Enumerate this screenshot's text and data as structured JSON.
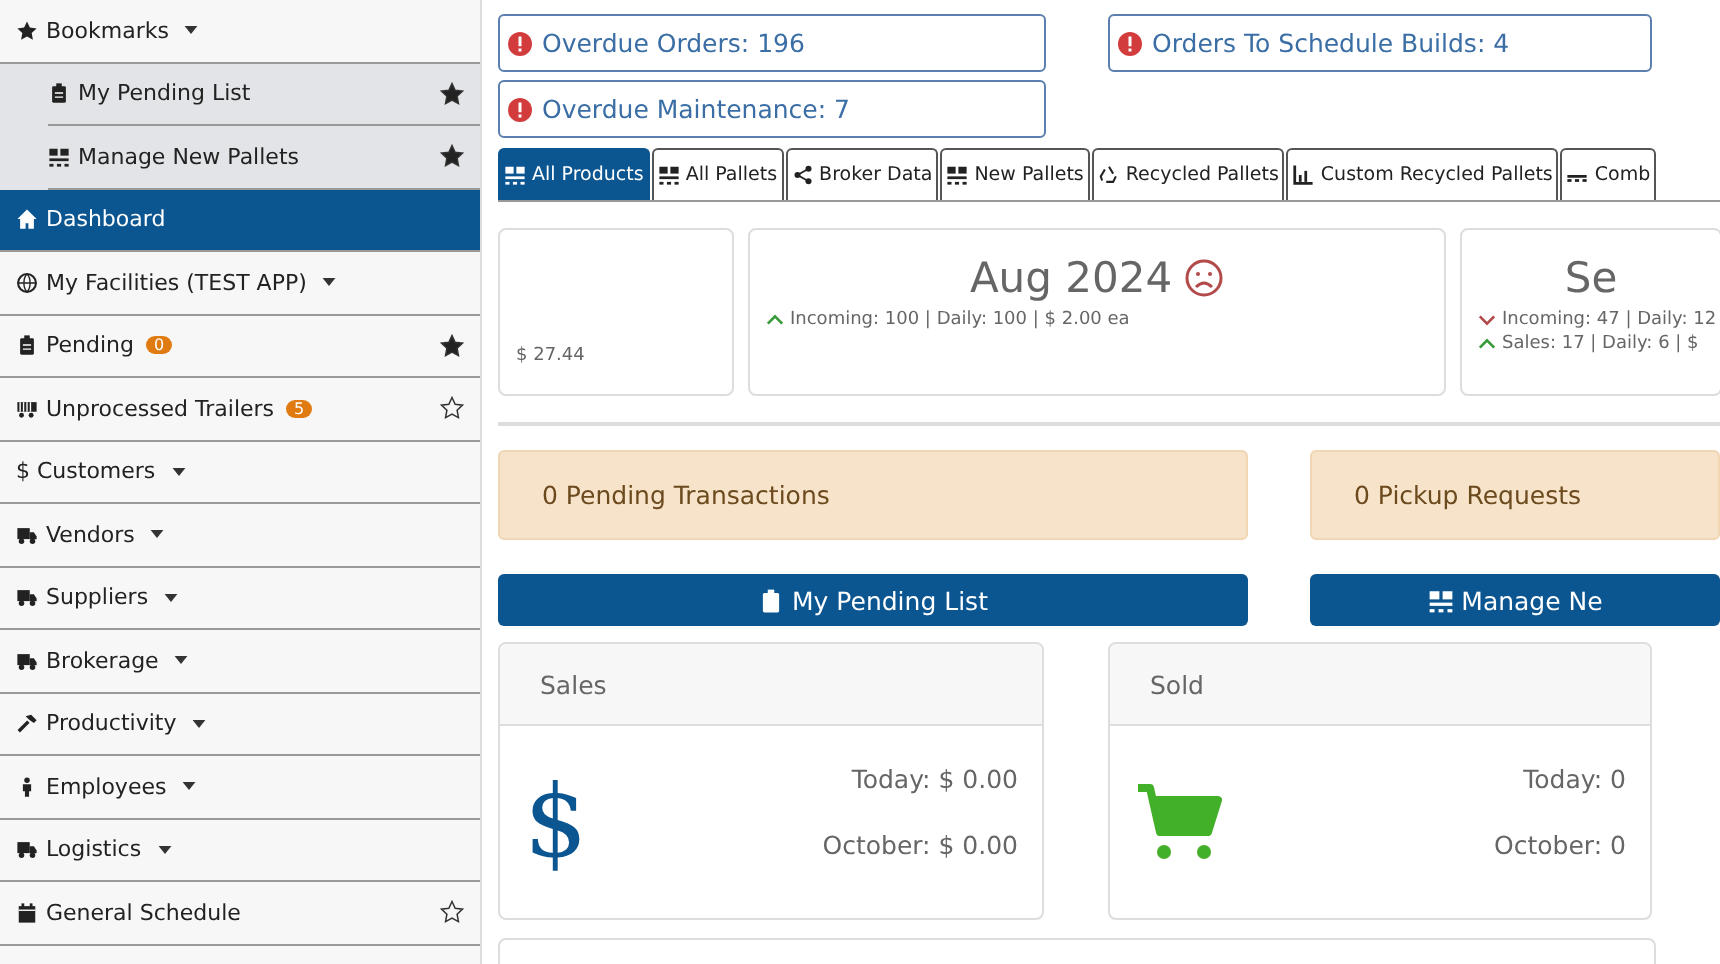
{
  "sidebar": {
    "items": [
      {
        "label": "Bookmarks",
        "dropdown": true,
        "selected": false,
        "children": [
          {
            "label": "My Pending List",
            "bookmarked": true,
            "selected": false
          },
          {
            "label": "Manage New Pallets",
            "bookmarked": true,
            "selected": false
          }
        ]
      },
      {
        "label": "Dashboard",
        "dropdown": false,
        "selected": true
      },
      {
        "label": "My Facilities (TEST APP)",
        "dropdown": true,
        "selected": false
      },
      {
        "label": "Pending",
        "dropdown": false,
        "badge": "0",
        "bookmarked": true,
        "selected": false
      },
      {
        "label": "Unprocessed Trailers",
        "dropdown": false,
        "badge": "5",
        "bookmarked": false,
        "selected": false
      },
      {
        "label": "$ Customers",
        "dropdown": true,
        "selected": false
      },
      {
        "label": "Vendors",
        "dropdown": true,
        "selected": false
      },
      {
        "label": "Suppliers",
        "dropdown": true,
        "selected": false
      },
      {
        "label": "Brokerage",
        "dropdown": true,
        "selected": false
      },
      {
        "label": "Productivity",
        "dropdown": true,
        "selected": false
      },
      {
        "label": "Employees",
        "dropdown": true,
        "selected": false
      },
      {
        "label": "Logistics",
        "dropdown": true,
        "selected": false
      },
      {
        "label": "General Schedule",
        "dropdown": false,
        "bookmarked": false,
        "selected": false
      }
    ]
  },
  "alerts": [
    {
      "text": "Overdue Orders: 196"
    },
    {
      "text": "Orders To Schedule Builds: 4"
    },
    {
      "text": "Overdue Maintenance: 7"
    }
  ],
  "tabs": [
    {
      "label": "All Products",
      "selected": true
    },
    {
      "label": "All Pallets",
      "selected": false
    },
    {
      "label": "Broker Data",
      "selected": false
    },
    {
      "label": "New Pallets",
      "selected": false
    },
    {
      "label": "Recycled Pallets",
      "selected": false
    },
    {
      "label": "Custom Recycled Pallets",
      "selected": false
    },
    {
      "label": "Comb",
      "selected": false
    }
  ],
  "stats": [
    {
      "lines": [
        {
          "text": "$ 27.44"
        }
      ]
    },
    {
      "title": "Aug 2024",
      "sad": true,
      "lines": [
        {
          "rising": true,
          "text": "Incoming: 100 | Daily: 100 | $ 2.00 ea"
        }
      ]
    },
    {
      "title": "Se",
      "sad": false,
      "lines": [
        {
          "rising": false,
          "text": "Incoming: 47 | Daily: 12"
        },
        {
          "rising": true,
          "text": "Sales: 17 | Daily: 6 | $"
        }
      ]
    }
  ],
  "notices": [
    {
      "text": "0 Pending Transactions"
    },
    {
      "text": "0 Pickup Requests"
    }
  ],
  "buttons": [
    {
      "label": "My Pending List"
    },
    {
      "label": "Manage Ne"
    }
  ],
  "panels": [
    {
      "title": "Sales",
      "kind": "money",
      "symbol": "$",
      "rows": [
        "Today: $ 0.00",
        "October: $ 0.00"
      ]
    },
    {
      "title": "Sold",
      "kind": "cart",
      "rows": [
        "Today: 0",
        "October: 0"
      ]
    }
  ]
}
